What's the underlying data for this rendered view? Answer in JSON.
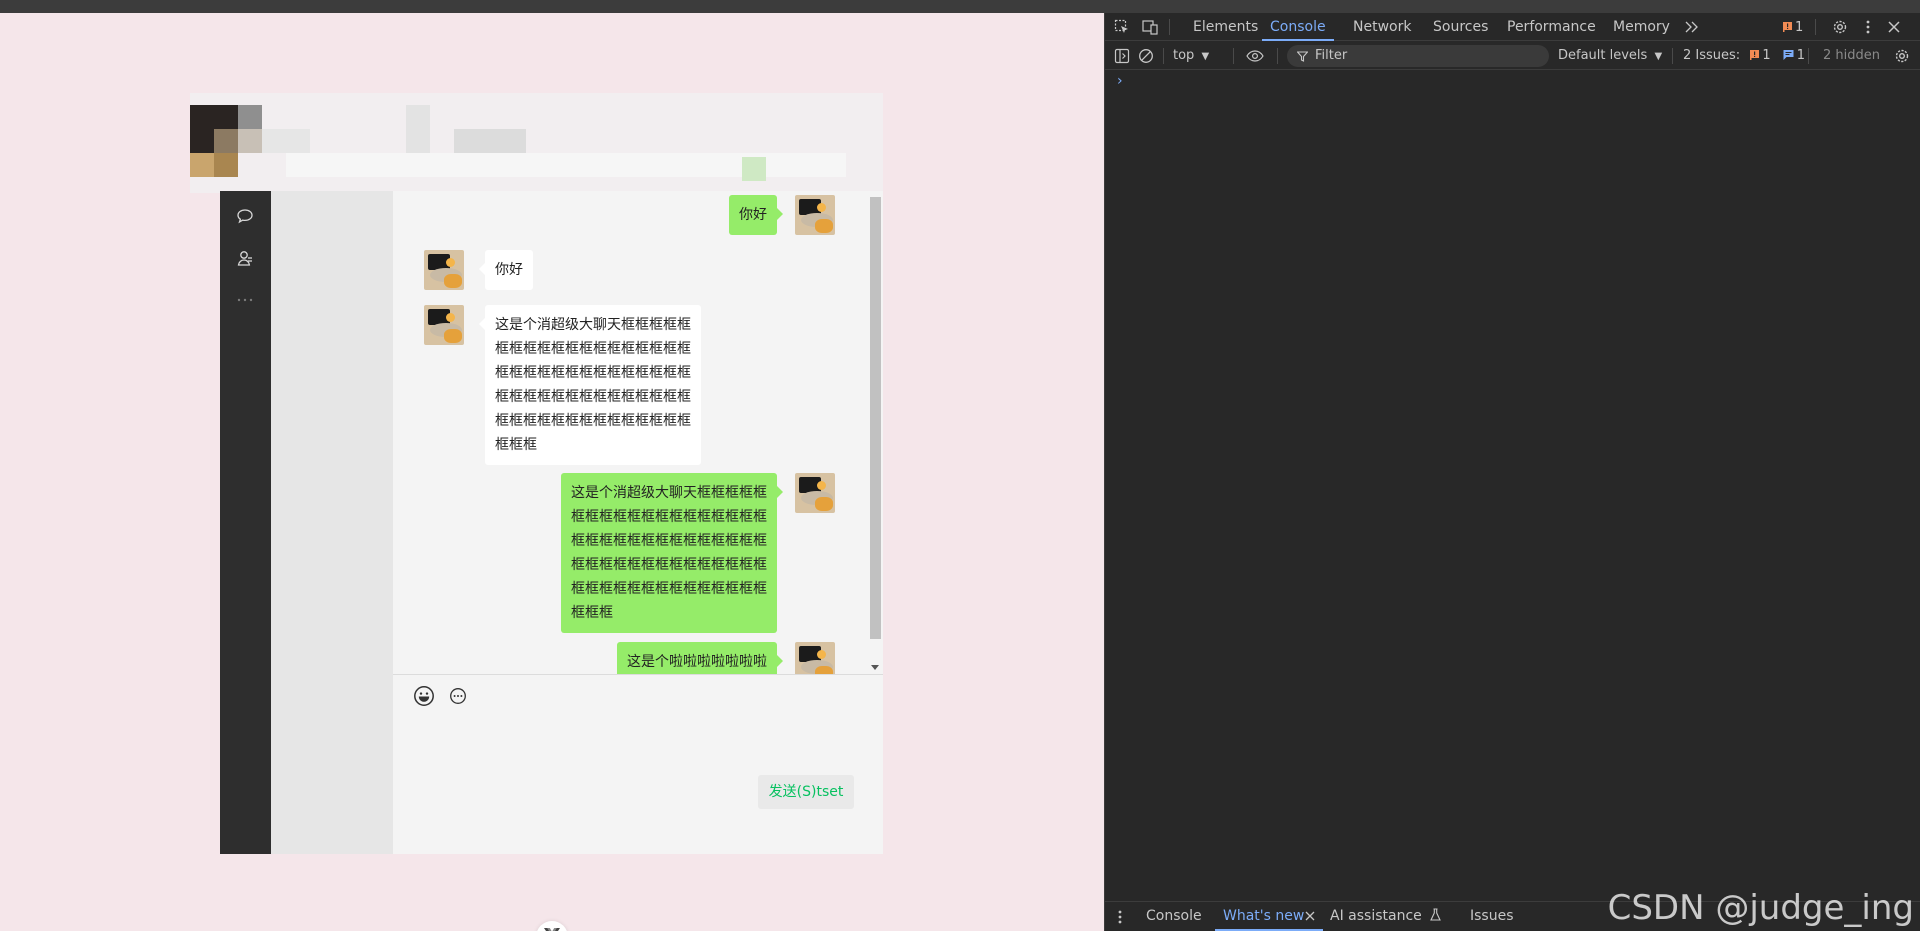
{
  "chat": {
    "messages": [
      {
        "side": "me",
        "text": "你好"
      },
      {
        "side": "them",
        "text": "你好"
      },
      {
        "side": "them",
        "text": "这是个消超级大聊天框框框框框框框框框框框框框框框框框框框框框框框框框框框框框框框框框框框框框框框框框框框框框框框框框框框框框框框框框框框框框框框框"
      },
      {
        "side": "me",
        "text": "这是个消超级大聊天框框框框框框框框框框框框框框框框框框框框框框框框框框框框框框框框框框框框框框框框框框框框框框框框框框框框框框框框框框框框框框框框"
      },
      {
        "side": "me",
        "text": "这是个啦啦啦啦啦啦啦"
      }
    ],
    "send_label": "发送(S)tset",
    "icons": {
      "nav": [
        "chat-bubble-icon",
        "contacts-icon",
        "more-dots-icon"
      ],
      "toolbar": [
        "emoji-icon",
        "more-options-icon"
      ]
    },
    "colors": {
      "my_bubble": "#95ec69",
      "their_bubble": "#ffffff",
      "nav_bg": "#2e2e2e",
      "send_text": "#07c160"
    }
  },
  "devtools": {
    "tabs": [
      "Elements",
      "Console",
      "Network",
      "Sources",
      "Performance",
      "Memory"
    ],
    "active_tab": "Console",
    "error_count": "1",
    "context": "top",
    "filter_placeholder": "Filter",
    "levels": "Default levels",
    "issues_label": "2 Issues:",
    "issues_error": "1",
    "issues_info": "1",
    "hidden": "2 hidden",
    "prompt": "›",
    "drawer_tabs": [
      "Console",
      "What's new",
      "AI assistance",
      "Issues"
    ],
    "active_drawer_tab": "What's new",
    "accent": "#7cacf8"
  },
  "watermark": "CSDN @judge_ing"
}
